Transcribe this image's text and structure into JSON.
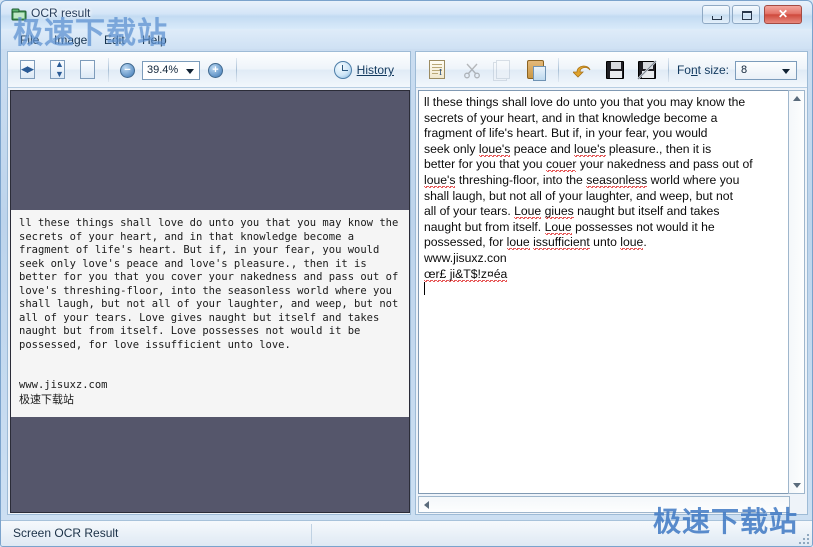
{
  "window": {
    "title": "OCR result",
    "icon": "app-window-icon",
    "controls": {
      "minimize": "minimize",
      "maximize": "maximize",
      "close": "✕"
    }
  },
  "menubar": {
    "items": [
      {
        "label": "File",
        "name": "menu-file"
      },
      {
        "label": "Image",
        "name": "menu-image"
      },
      {
        "label": "Edit",
        "name": "menu-edit"
      },
      {
        "label": "Help",
        "name": "menu-help"
      }
    ]
  },
  "watermarks": {
    "top": "极速下载站",
    "bottom": "极速下载站"
  },
  "image_toolbar": {
    "fit_width": "fit-width",
    "fit_height": "fit-height",
    "actual_size": "actual-size",
    "zoom_out": "−",
    "zoom_in": "+",
    "zoom_value": "39.4%",
    "history_label": "History",
    "history_accesskey": "H"
  },
  "text_toolbar": {
    "select_all": "select-all",
    "cut": "cut",
    "copy": "copy",
    "paste": "paste",
    "undo": "undo",
    "save": "save",
    "save_as": "save-as",
    "font_size_label_pre": "Fo",
    "font_size_label_key": "n",
    "font_size_label_post": "t size:",
    "font_size_value": "8"
  },
  "image_panel": {
    "background_color": "#55566b",
    "source_text": "ll these things shall love do unto you that you may know the\nsecrets of your heart, and in that knowledge become a\nfragment of life's heart. But if, in your fear, you would\nseek only love's peace and love's pleasure., then it is\nbetter for you that you cover your nakedness and pass out of\nlove's threshing-floor, into the seasonless world where you\nshall laugh, but not all of your laughter, and weep, but not\nall of your tears. Love gives naught but itself and takes\nnaught but from itself. Love possesses not would it be\npossessed, for love issufficient unto love.\n\n\nwww.jisuxz.com",
    "source_watermark": "极速下载站"
  },
  "text_panel": {
    "lines": [
      [
        {
          "t": "ll these things shall love do unto you that you may know the",
          "sq": false
        }
      ],
      [
        {
          "t": "secrets of your heart, and in that knowledge become a",
          "sq": false
        }
      ],
      [
        {
          "t": "fragment of life's heart. But if, in your fear, you would",
          "sq": false
        }
      ],
      [
        {
          "t": "seek only ",
          "sq": false
        },
        {
          "t": "loue's",
          "sq": true
        },
        {
          "t": " peace and ",
          "sq": false
        },
        {
          "t": "loue's",
          "sq": true
        },
        {
          "t": " pleasure., then it is",
          "sq": false
        }
      ],
      [
        {
          "t": "better for you that you ",
          "sq": false
        },
        {
          "t": "couer",
          "sq": true
        },
        {
          "t": " your nakedness and pass out of",
          "sq": false
        }
      ],
      [
        {
          "t": "loue's",
          "sq": true
        },
        {
          "t": " threshing-floor, into the ",
          "sq": false
        },
        {
          "t": "seasonless",
          "sq": true
        },
        {
          "t": " world where you",
          "sq": false
        }
      ],
      [
        {
          "t": "shall laugh, but not all of your laughter, and weep, but not",
          "sq": false
        }
      ],
      [
        {
          "t": "all of your tears. ",
          "sq": false
        },
        {
          "t": "Loue",
          "sq": true
        },
        {
          "t": " ",
          "sq": false
        },
        {
          "t": "giues",
          "sq": true
        },
        {
          "t": " naught but itself and takes",
          "sq": false
        }
      ],
      [
        {
          "t": "naught but from itself. ",
          "sq": false
        },
        {
          "t": "Loue",
          "sq": true
        },
        {
          "t": " possesses not would it he",
          "sq": false
        }
      ],
      [
        {
          "t": "possessed, for ",
          "sq": false
        },
        {
          "t": "loue",
          "sq": true
        },
        {
          "t": " ",
          "sq": false
        },
        {
          "t": "issufficient",
          "sq": true
        },
        {
          "t": " unto ",
          "sq": false
        },
        {
          "t": "loue",
          "sq": true
        },
        {
          "t": ".",
          "sq": false
        }
      ],
      [
        {
          "t": "www.jisuxz.con",
          "sq": false
        }
      ],
      [
        {
          "t": "œr£ ji&T$!z¤éa",
          "sq": true
        }
      ]
    ]
  },
  "statusbar": {
    "text": "Screen OCR Result"
  }
}
